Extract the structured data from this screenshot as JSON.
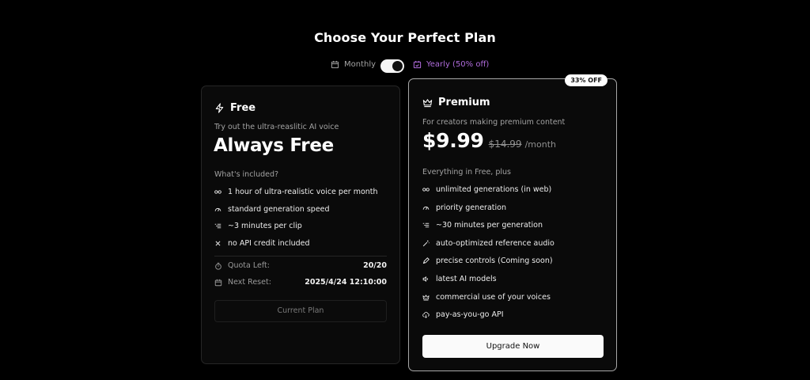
{
  "page": {
    "title": "Choose Your Perfect Plan"
  },
  "billing": {
    "monthly_label": "Monthly",
    "yearly_label": "Yearly (50% off)",
    "toggle_state": "yearly",
    "yearly_color": "#b06cdc"
  },
  "free_plan": {
    "name": "Free",
    "icon": "lightning-icon",
    "description": "Try out the ultra-reaslitic AI voice",
    "price_text": "Always Free",
    "included_label": "What's included?",
    "features": [
      {
        "icon": "infinity-icon",
        "text": "1 hour of ultra-realistic voice per month"
      },
      {
        "icon": "gauge-icon",
        "text": "standard generation speed"
      },
      {
        "icon": "list-icon",
        "text": "~3 minutes per clip"
      },
      {
        "icon": "x-icon",
        "text": "no API credit included"
      }
    ],
    "quota_label": "Quota Left:",
    "quota_value": "20/20",
    "reset_label": "Next Reset:",
    "reset_value": "2025/4/24 12:10:00",
    "button_label": "Current Plan"
  },
  "premium_plan": {
    "name": "Premium",
    "icon": "crown-icon",
    "badge": "33% OFF",
    "description": "For creators making premium content",
    "price": "$9.99",
    "old_price": "$14.99",
    "period": "/month",
    "included_label": "Everything in Free, plus",
    "features": [
      {
        "icon": "infinity-icon",
        "text": "unlimited generations (in web)"
      },
      {
        "icon": "gauge-icon",
        "text": "priority generation"
      },
      {
        "icon": "list-icon",
        "text": "~30 minutes per generation"
      },
      {
        "icon": "wand-icon",
        "text": "auto-optimized reference audio"
      },
      {
        "icon": "pen-icon",
        "text": "precise controls (Coming soon)"
      },
      {
        "icon": "speaker-icon",
        "text": "latest AI models"
      },
      {
        "icon": "crown-icon",
        "text": "commercial use of your voices"
      },
      {
        "icon": "cloud-icon",
        "text": "pay-as-you-go API"
      }
    ],
    "button_label": "Upgrade Now"
  }
}
